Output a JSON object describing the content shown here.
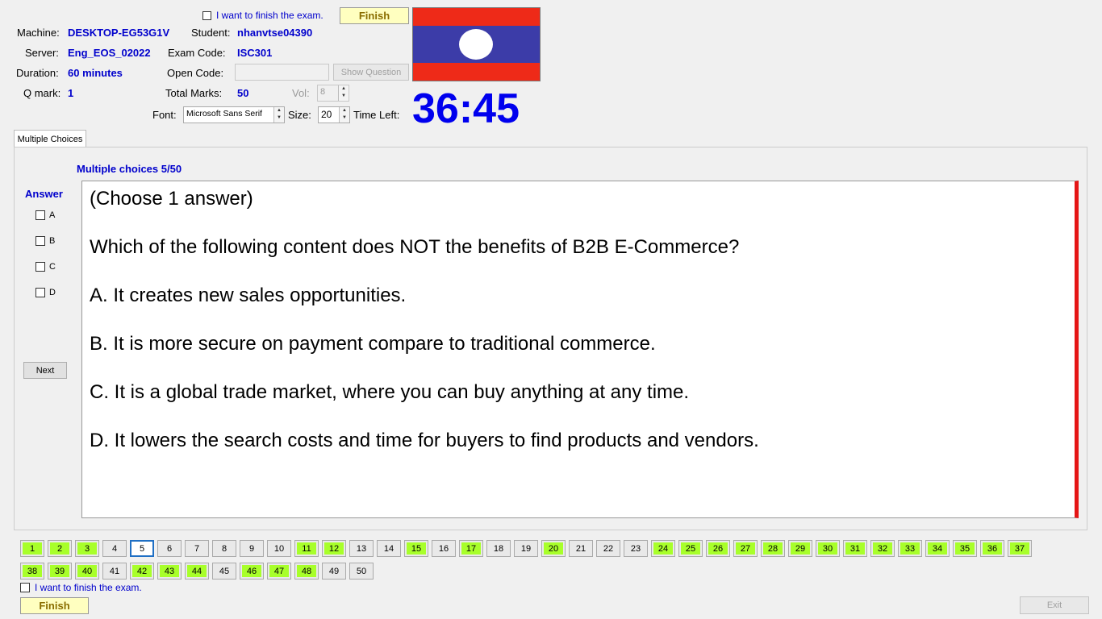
{
  "header": {
    "finish_checkbox_label": "I want to finish the exam.",
    "finish_button": "Finish",
    "machine_label": "Machine:",
    "machine_value": "DESKTOP-EG53G1V",
    "student_label": "Student:",
    "student_value": "nhanvtse04390",
    "server_label": "Server:",
    "server_value": "Eng_EOS_02022",
    "exam_code_label": "Exam Code:",
    "exam_code_value": "ISC301",
    "duration_label": "Duration:",
    "duration_value": "60 minutes",
    "open_code_label": "Open Code:",
    "open_code_value": "",
    "show_question_button": "Show Question",
    "qmark_label": "Q mark:",
    "qmark_value": "1",
    "total_marks_label": "Total Marks:",
    "total_marks_value": "50",
    "vol_label": "Vol:",
    "vol_value": "8",
    "font_label": "Font:",
    "font_value": "Microsoft Sans Serif",
    "size_label": "Size:",
    "size_value": "20",
    "time_left_label": "Time Left:",
    "timer": "36:45"
  },
  "flag": {
    "top_color": "#ee2a18",
    "middle_color": "#3c3ca8",
    "circle_color": "#ffffff"
  },
  "tab": {
    "label": "Multiple Choices"
  },
  "question": {
    "counter": "Multiple choices 5/50",
    "answer_label": "Answer",
    "options": [
      "A",
      "B",
      "C",
      "D"
    ],
    "next_button": "Next",
    "lines": [
      "(Choose 1 answer)",
      "Which of the following content does NOT the benefits of B2B E-Commerce?",
      "A.  It creates new sales opportunities.",
      "B.  It is more secure on payment compare to traditional commerce.",
      "C.  It is a global trade market, where you can buy anything at any time.",
      "D.  It lowers the search costs and time for buyers to find products and vendors."
    ]
  },
  "navigation": {
    "current": 5,
    "answered_color": "#a8ff2a",
    "buttons": [
      {
        "n": "1",
        "answered": true
      },
      {
        "n": "2",
        "answered": true
      },
      {
        "n": "3",
        "answered": true
      },
      {
        "n": "4",
        "answered": false
      },
      {
        "n": "5",
        "answered": false
      },
      {
        "n": "6",
        "answered": false
      },
      {
        "n": "7",
        "answered": false
      },
      {
        "n": "8",
        "answered": false
      },
      {
        "n": "9",
        "answered": false
      },
      {
        "n": "10",
        "answered": false
      },
      {
        "n": "11",
        "answered": true
      },
      {
        "n": "12",
        "answered": true
      },
      {
        "n": "13",
        "answered": false
      },
      {
        "n": "14",
        "answered": false
      },
      {
        "n": "15",
        "answered": true
      },
      {
        "n": "16",
        "answered": false
      },
      {
        "n": "17",
        "answered": true
      },
      {
        "n": "18",
        "answered": false
      },
      {
        "n": "19",
        "answered": false
      },
      {
        "n": "20",
        "answered": true
      },
      {
        "n": "21",
        "answered": false
      },
      {
        "n": "22",
        "answered": false
      },
      {
        "n": "23",
        "answered": false
      },
      {
        "n": "24",
        "answered": true
      },
      {
        "n": "25",
        "answered": true
      },
      {
        "n": "26",
        "answered": true
      },
      {
        "n": "27",
        "answered": true
      },
      {
        "n": "28",
        "answered": true
      },
      {
        "n": "29",
        "answered": true
      },
      {
        "n": "30",
        "answered": true
      },
      {
        "n": "31",
        "answered": true
      },
      {
        "n": "32",
        "answered": true
      },
      {
        "n": "33",
        "answered": true
      },
      {
        "n": "34",
        "answered": true
      },
      {
        "n": "35",
        "answered": true
      },
      {
        "n": "36",
        "answered": true
      },
      {
        "n": "37",
        "answered": true
      },
      {
        "n": "38",
        "answered": true
      },
      {
        "n": "39",
        "answered": true
      },
      {
        "n": "40",
        "answered": true
      },
      {
        "n": "41",
        "answered": false
      },
      {
        "n": "42",
        "answered": true
      },
      {
        "n": "43",
        "answered": true
      },
      {
        "n": "44",
        "answered": true
      },
      {
        "n": "45",
        "answered": false
      },
      {
        "n": "46",
        "answered": true
      },
      {
        "n": "47",
        "answered": true
      },
      {
        "n": "48",
        "answered": true
      },
      {
        "n": "49",
        "answered": false
      },
      {
        "n": "50",
        "answered": false
      }
    ]
  },
  "footer": {
    "finish_checkbox_label": "I want to finish the exam.",
    "finish_button": "Finish",
    "exit_button": "Exit"
  }
}
